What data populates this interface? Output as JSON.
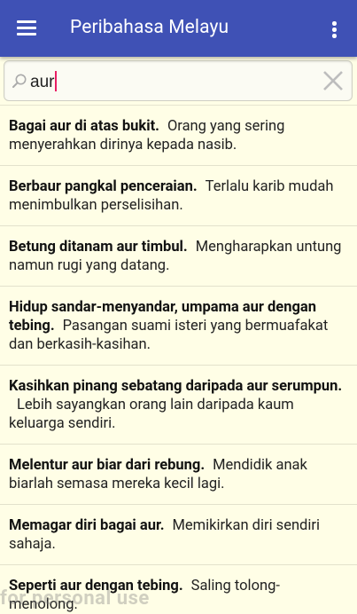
{
  "app": {
    "title": "Peribahasa Melayu",
    "accent_color": "#3f51b5",
    "menu_icon": "hamburger-menu-icon",
    "overflow_icon": "more-vert-icon"
  },
  "search": {
    "value": "aur",
    "clear_icon": "close-icon",
    "search_icon": "search-icon"
  },
  "results": [
    {
      "proverb": "Bagai aur di atas bukit.",
      "meaning": "Orang yang sering menyerahkan dirinya kepada nasib."
    },
    {
      "proverb": "Berbaur pangkal penceraian.",
      "meaning": "Terlalu karib mudah menimbulkan perselisihan."
    },
    {
      "proverb": "Betung ditanam aur timbul.",
      "meaning": "Mengharapkan untung namun rugi yang datang."
    },
    {
      "proverb": "Hidup sandar-menyandar, umpama aur dengan tebing.",
      "meaning": "Pasangan suami isteri yang bermuafakat dan berkasih-kasihan."
    },
    {
      "proverb": "Kasihkan pinang sebatang daripada aur serumpun.",
      "meaning": "Lebih sayangkan orang lain daripada kaum keluarga sendiri."
    },
    {
      "proverb": "Melentur aur biar dari rebung.",
      "meaning": "Mendidik anak biarlah semasa mereka kecil lagi."
    },
    {
      "proverb": "Memagar diri bagai aur.",
      "meaning": "Memikirkan diri sendiri sahaja."
    },
    {
      "proverb": "Seperti aur dengan tebing.",
      "meaning": "Saling tolong-menolong."
    }
  ],
  "watermark": "for personal use"
}
